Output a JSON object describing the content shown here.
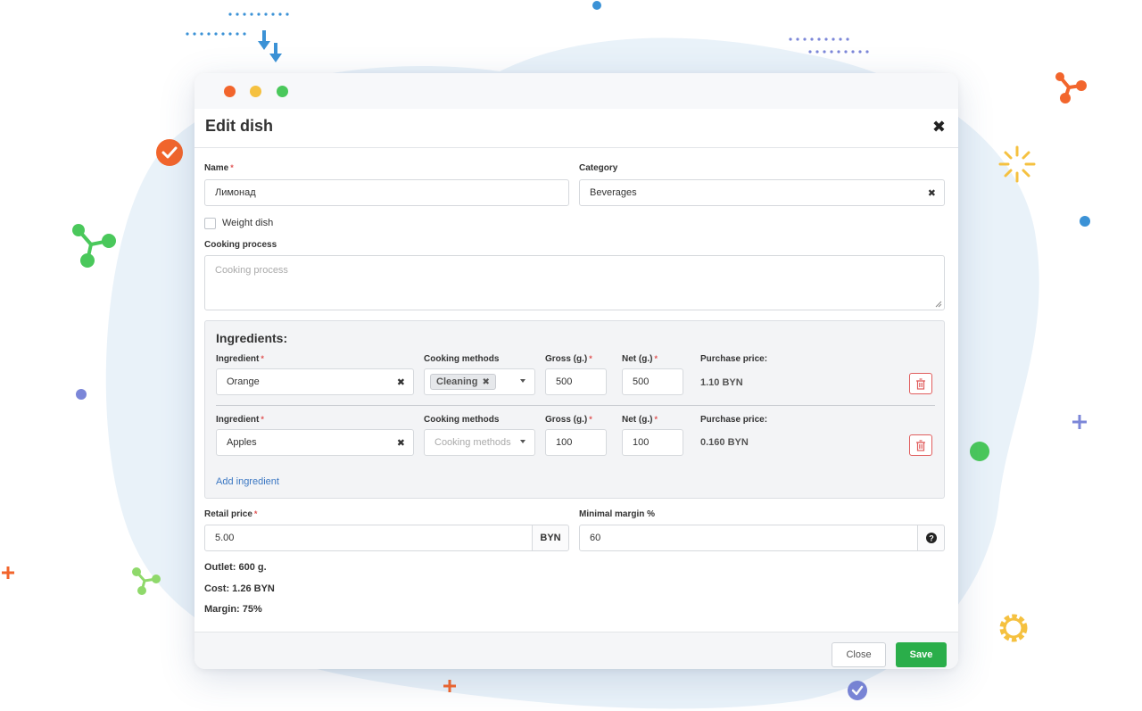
{
  "dialog": {
    "title": "Edit dish"
  },
  "form": {
    "name_label": "Name",
    "name_value": "Лимонад",
    "category_label": "Category",
    "category_value": "Beverages",
    "weight_dish_label": "Weight dish",
    "weight_dish_checked": false,
    "cooking_process_label": "Cooking process",
    "cooking_process_placeholder": "Cooking process"
  },
  "ingredients": {
    "title": "Ingredients:",
    "col_ingredient": "Ingredient",
    "col_methods": "Cooking methods",
    "col_gross": "Gross (g.)",
    "col_net": "Net (g.)",
    "col_price": "Purchase price:",
    "methods_placeholder": "Cooking methods",
    "rows": [
      {
        "ingredient": "Orange",
        "method_tag": "Cleaning",
        "gross": "500",
        "net": "500",
        "price": "1.10 BYN"
      },
      {
        "ingredient": "Apples",
        "method_tag": "",
        "gross": "100",
        "net": "100",
        "price": "0.160 BYN"
      }
    ],
    "add_label": "Add ingredient"
  },
  "pricing": {
    "retail_label": "Retail price",
    "retail_value": "5.00",
    "currency": "BYN",
    "margin_label": "Minimal margin %",
    "margin_value": "60"
  },
  "summary": {
    "outlet": "Outlet: 600 g.",
    "cost": "Cost: 1.26 BYN",
    "margin": "Margin: 75%"
  },
  "footer": {
    "close_label": "Close",
    "save_label": "Save"
  },
  "icons": {
    "close": "close-icon",
    "clear": "clear-icon",
    "remove_tag": "remove-tag-icon",
    "dropdown": "chevron-down-icon",
    "trash": "trash-icon",
    "help": "help-icon"
  },
  "colors": {
    "accent_save": "#2aae4a",
    "link": "#3c78c3",
    "required": "#e05555",
    "danger": "#e05d5d"
  }
}
